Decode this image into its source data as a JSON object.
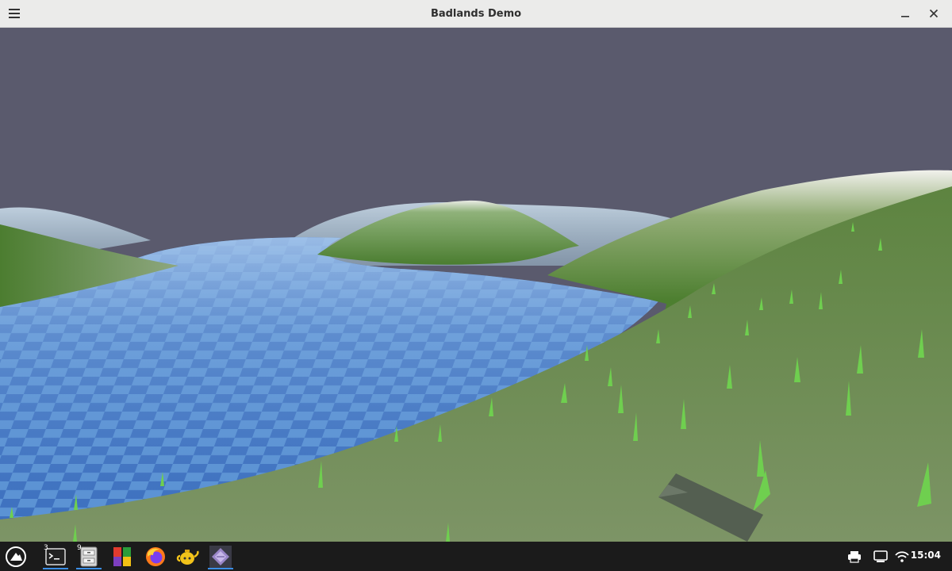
{
  "window": {
    "title": "Badlands Demo"
  },
  "taskbar": {
    "items": [
      {
        "name": "terminal",
        "badge": "3"
      },
      {
        "name": "file-manager",
        "badge": "9"
      },
      {
        "name": "app-grid"
      },
      {
        "name": "firefox"
      },
      {
        "name": "teapot-app"
      },
      {
        "name": "godot-app"
      }
    ],
    "clock": "15:04"
  },
  "colors": {
    "sky": "#5a5a6d",
    "grass": "#4f7d34",
    "water": "#4f84c4",
    "taskbar": "#1b1b1b",
    "titlebar": "#ebebea",
    "active_indicator": "#3a8ee6"
  }
}
